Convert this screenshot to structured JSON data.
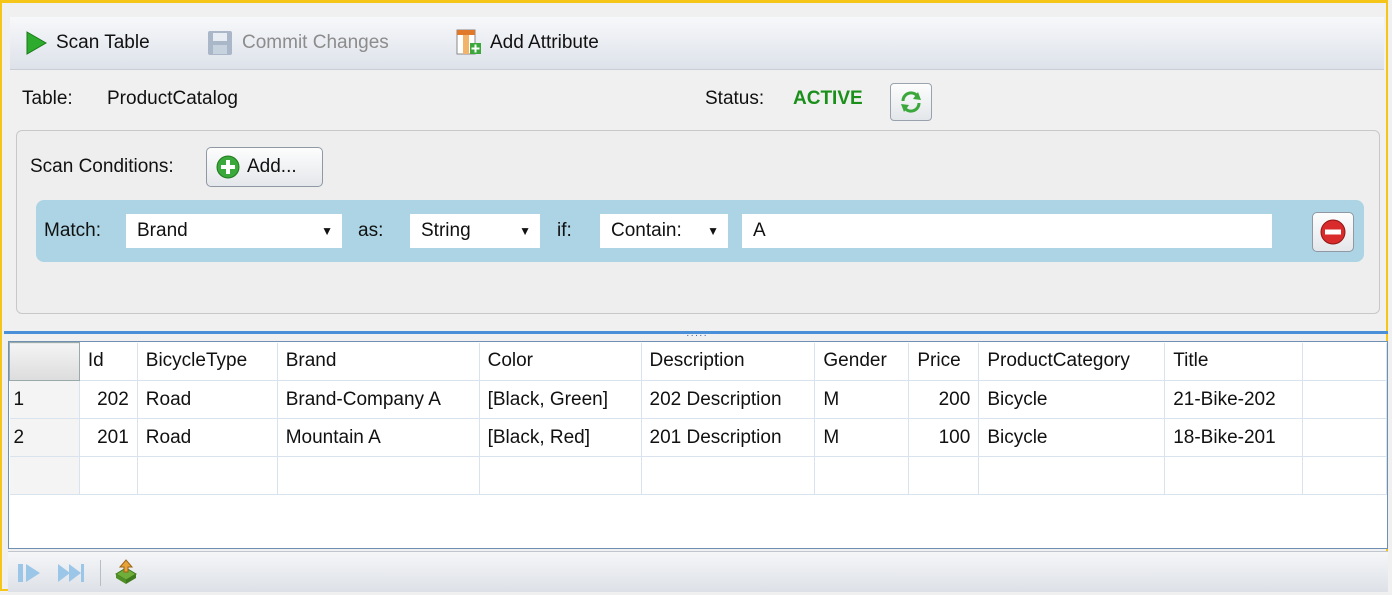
{
  "toolbar": {
    "scan_label": "Scan Table",
    "commit_label": "Commit Changes",
    "add_attribute_label": "Add Attribute"
  },
  "info": {
    "table_label": "Table:",
    "table_name": "ProductCatalog",
    "status_label": "Status:",
    "status_value": "ACTIVE"
  },
  "conditions": {
    "label": "Scan Conditions:",
    "add_label": "Add...",
    "match_label": "Match:",
    "match_value": "Brand",
    "as_label": "as:",
    "type_value": "String",
    "if_label": "if:",
    "operator_value": "Contain:",
    "value": "A"
  },
  "grid": {
    "columns": [
      "Id",
      "BicycleType",
      "Brand",
      "Color",
      "Description",
      "Gender",
      "Price",
      "ProductCategory",
      "Title"
    ],
    "rows": [
      {
        "num": "1",
        "cells": [
          "202",
          "Road",
          "Brand-Company A",
          "[Black, Green]",
          "202 Description",
          "M",
          "200",
          "Bicycle",
          "21-Bike-202"
        ]
      },
      {
        "num": "2",
        "cells": [
          "201",
          "Road",
          "Mountain A",
          "[Black, Red]",
          "201 Description",
          "M",
          "100",
          "Bicycle",
          "18-Bike-201"
        ]
      }
    ]
  },
  "colors": {
    "status_active": "#1a8f1a",
    "frame_border": "#f5c518",
    "condition_row": "#acd4e4",
    "splitter": "#4a90d9"
  },
  "icons": {
    "scan": "play-icon",
    "commit": "save-icon",
    "add_attribute": "add-column-icon",
    "refresh": "refresh-icon",
    "add_condition": "plus-circle-icon",
    "remove_condition": "minus-circle-icon",
    "next_page": "next-icon",
    "last_page": "fast-forward-icon",
    "export": "export-icon"
  }
}
